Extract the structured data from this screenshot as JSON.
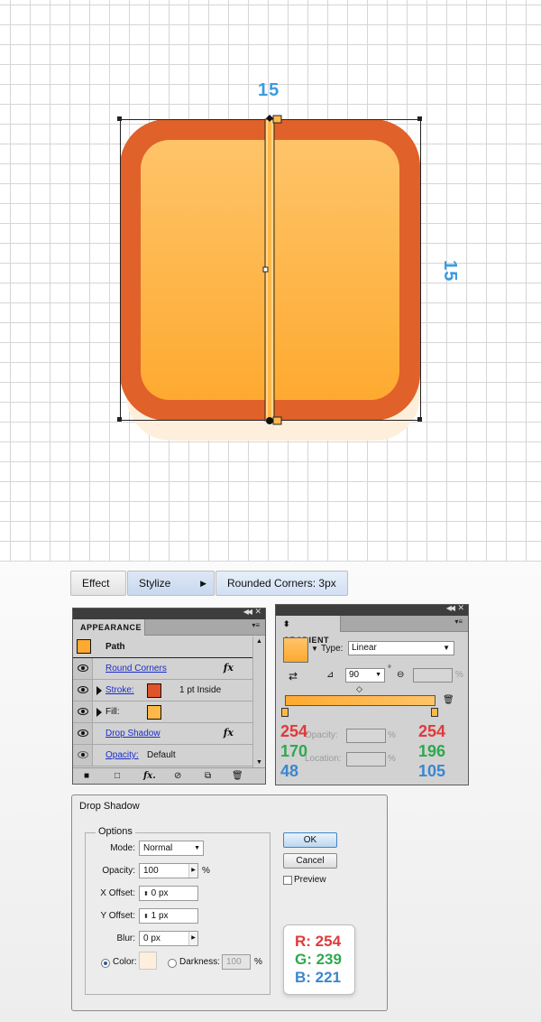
{
  "artboard": {
    "width_label": "15",
    "height_label": "15"
  },
  "breadcrumb": {
    "effect": "Effect",
    "stylize": "Stylize",
    "rounded": "Rounded Corners: 3px"
  },
  "appearance": {
    "tab": "APPEARANCE",
    "path_label": "Path",
    "rows": {
      "round_corners": "Round Corners",
      "stroke_label": "Stroke:",
      "stroke_value": "1 pt  Inside",
      "fill_label": "Fill:",
      "drop_shadow": "Drop Shadow",
      "opacity_label": "Opacity:",
      "opacity_value": "Default"
    },
    "colors": {
      "path_swatch": "#feaa30",
      "stroke_swatch": "#e0542a",
      "fill_swatch": "#feb84a"
    }
  },
  "gradient": {
    "tab": "GRADIENT",
    "type_label": "Type:",
    "type_value": "Linear",
    "angle_value": "90",
    "opacity_label": "Opacity:",
    "location_label": "Location:",
    "pct": "%",
    "left_stop": {
      "r": "254",
      "g": "170",
      "b": "48"
    },
    "right_stop": {
      "r": "254",
      "g": "196",
      "b": "105"
    }
  },
  "drop_shadow": {
    "title": "Drop Shadow",
    "options_legend": "Options",
    "mode_label": "Mode:",
    "mode_value": "Normal",
    "opacity_label": "Opacity:",
    "opacity_value": "100",
    "pct": "%",
    "x_label": "X Offset:",
    "x_value": "0 px",
    "y_label": "Y Offset:",
    "y_value": "1 px",
    "blur_label": "Blur:",
    "blur_value": "0 px",
    "color_label": "Color:",
    "darkness_label": "Darkness:",
    "darkness_value": "100",
    "ok": "OK",
    "cancel": "Cancel",
    "preview": "Preview",
    "shadow_color": "#feefdd",
    "rgb": {
      "r": "R: 254",
      "g": "G: 239",
      "b": "B: 221"
    }
  }
}
